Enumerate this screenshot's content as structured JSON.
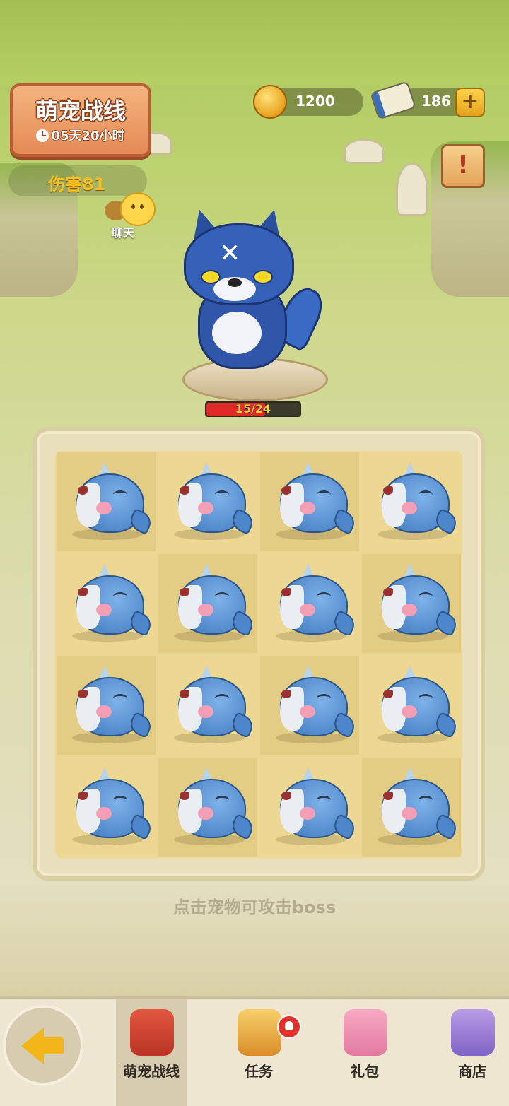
{
  "event": {
    "title": "萌宠战线",
    "countdown": "05天20小时"
  },
  "damage": {
    "label": "伤害81"
  },
  "chat": {
    "label": "聊天"
  },
  "currency": {
    "coins": "1200",
    "scrolls": "186",
    "add_label": "+"
  },
  "notice": {
    "label": "!"
  },
  "boss": {
    "hp_text": "15/24",
    "hp_current": 15,
    "hp_max": 24
  },
  "grid": {
    "rows": 4,
    "cols": 4,
    "pet_icon": "whale-pet-icon"
  },
  "hint": "点击宠物可攻击boss",
  "nav": {
    "tabs": [
      {
        "label": "萌宠战线",
        "icon": "dino-icon",
        "active": true
      },
      {
        "label": "任务",
        "icon": "task-icon",
        "badge": true
      },
      {
        "label": "礼包",
        "icon": "gift-icon"
      },
      {
        "label": "商店",
        "icon": "shop-icon"
      }
    ]
  },
  "colors": {
    "accent_gold": "#f3c125",
    "hp_red": "#e02a2a",
    "board_orange": "#e58a56"
  }
}
